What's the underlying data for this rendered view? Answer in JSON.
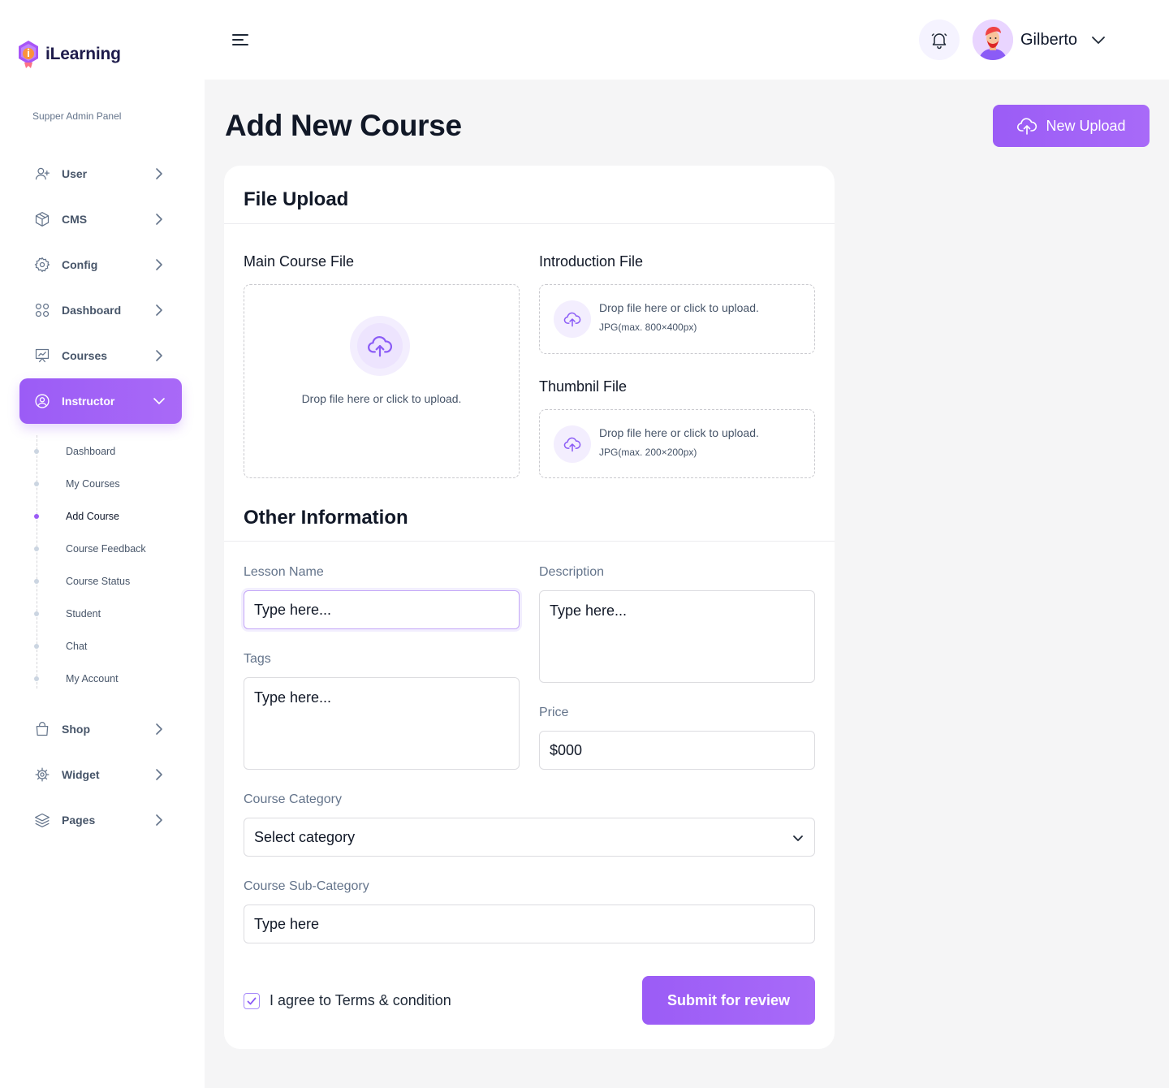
{
  "brand": {
    "name": "iLearning",
    "logo_icon": "ilearning-logo-icon"
  },
  "sidebar": {
    "panel_label": "Supper Admin Panel",
    "items": [
      {
        "label": "User",
        "icon": "user-plus-icon"
      },
      {
        "label": "CMS",
        "icon": "cube-icon"
      },
      {
        "label": "Config",
        "icon": "gear-icon"
      },
      {
        "label": "Dashboard",
        "icon": "grid-icon"
      },
      {
        "label": "Courses",
        "icon": "presentation-chart-icon"
      },
      {
        "label": "Instructor",
        "icon": "user-circle-icon",
        "active": true
      },
      {
        "label": "Shop",
        "icon": "shopping-bag-icon"
      },
      {
        "label": "Widget",
        "icon": "widget-gear-icon"
      },
      {
        "label": "Pages",
        "icon": "layers-icon"
      }
    ],
    "submenu": [
      {
        "label": "Dashboard"
      },
      {
        "label": "My Courses"
      },
      {
        "label": "Add Course",
        "current": true
      },
      {
        "label": "Course Feedback"
      },
      {
        "label": "Course Status"
      },
      {
        "label": "Student"
      },
      {
        "label": "Chat"
      },
      {
        "label": "My Account"
      }
    ]
  },
  "header": {
    "menu_icon": "hamburger-menu-icon",
    "notification_icon": "bell-icon",
    "user_name": "Gilberto"
  },
  "page": {
    "title": "Add New Course",
    "new_upload_label": "New Upload"
  },
  "file_upload": {
    "title": "File Upload",
    "main_file": {
      "label": "Main Course File",
      "drop_text": "Drop file here or click to upload."
    },
    "intro_file": {
      "label": "Introduction File",
      "drop_text": "Drop file here or click to upload.",
      "hint": "JPG(max. 800×400px)"
    },
    "thumbnail_file": {
      "label": "Thumbnil File",
      "drop_text": "Drop file here or click to upload.",
      "hint": "JPG(max. 200×200px)"
    }
  },
  "other_info": {
    "title": "Other Information",
    "lesson_name": {
      "label": "Lesson Name",
      "placeholder": "Type here..."
    },
    "description": {
      "label": "Description",
      "placeholder": "Type here..."
    },
    "tags": {
      "label": "Tags",
      "placeholder": "Type here..."
    },
    "price": {
      "label": "Price",
      "value": "$000"
    },
    "category": {
      "label": "Course Category",
      "selected": "Select category"
    },
    "sub_category": {
      "label": "Course Sub-Category",
      "placeholder": "Type here"
    }
  },
  "footer": {
    "agree_text": "I agree to Terms & condition",
    "agree_checked": true,
    "submit_label": "Submit for review"
  },
  "colors": {
    "accent": "#9B5CF6",
    "accent_light": "#F3EEFE",
    "background": "#F5F5F6",
    "text_dark": "#111827",
    "text_muted": "#64748B"
  }
}
